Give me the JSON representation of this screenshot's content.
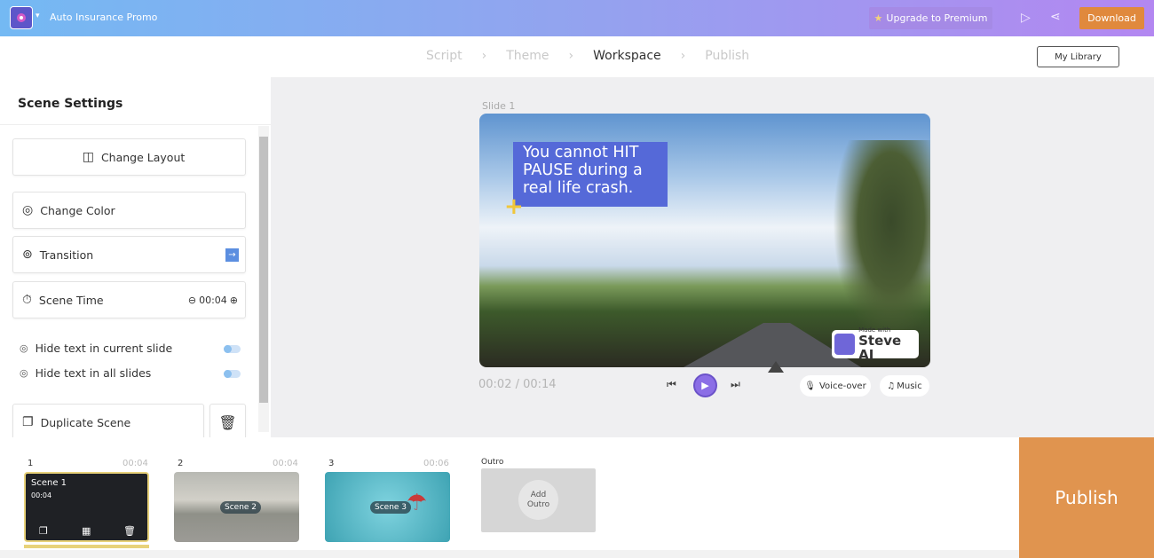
{
  "header": {
    "project_title": "Auto Insurance Promo",
    "upgrade_label": "Upgrade to Premium",
    "download_label": "Download",
    "brand_color": "#8b6ee6",
    "download_color": "#e0893d"
  },
  "steps": {
    "items": [
      "Script",
      "Theme",
      "Workspace",
      "Publish"
    ],
    "active": "Workspace",
    "my_library": "My Library"
  },
  "sidebar": {
    "title": "Scene Settings",
    "change_layout": "Change Layout",
    "change_color": "Change Color",
    "transition": "Transition",
    "scene_time": "Scene Time",
    "scene_time_value": "00:04",
    "hide_current": "Hide text in current slide",
    "hide_all": "Hide text in all slides",
    "duplicate": "Duplicate Scene"
  },
  "stage": {
    "slide_label": "Slide 1",
    "caption": "You cannot HIT PAUSE during a real life crash.",
    "watermark_small": "Made with",
    "watermark_big": "Steve AI"
  },
  "player": {
    "time": "00:02 / 00:14",
    "voiceover": "Voice-over",
    "music": "Music"
  },
  "scenes": [
    {
      "num": "1",
      "duration": "00:04",
      "label": "Scene 1",
      "sub": "00:04"
    },
    {
      "num": "2",
      "duration": "00:04",
      "label": "Scene 2"
    },
    {
      "num": "3",
      "duration": "00:06",
      "label": "Scene 3"
    }
  ],
  "outro": {
    "title": "Outro",
    "add": "Add Outro"
  },
  "publish": "Publish"
}
